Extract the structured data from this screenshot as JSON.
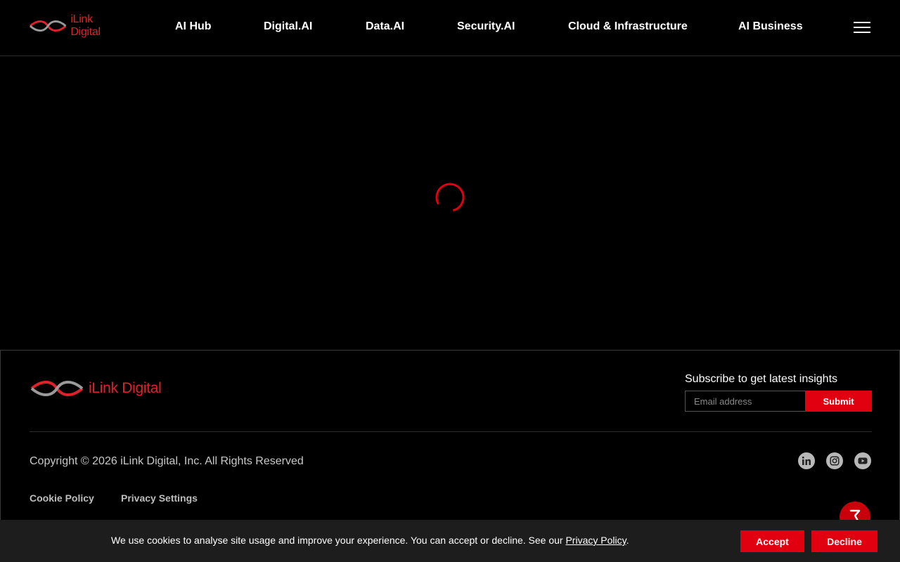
{
  "header": {
    "logo_text": "iLink Digital",
    "nav": [
      {
        "label": "AI Hub"
      },
      {
        "label": "Digital.AI"
      },
      {
        "label": "Data.AI"
      },
      {
        "label": "Security.AI"
      },
      {
        "label": "Cloud & Infrastructure"
      },
      {
        "label": "AI Business"
      }
    ]
  },
  "footer": {
    "logo_text": "iLink Digital",
    "subscribe": {
      "title": "Subscribe to get latest insights",
      "placeholder": "Email address",
      "submit_label": "Submit"
    },
    "copyright": "Copyright © 2026 iLink Digital, Inc. All Rights Reserved",
    "social": [
      "linkedin-icon",
      "instagram-icon",
      "youtube-icon"
    ],
    "links": [
      {
        "label": "Cookie Policy"
      },
      {
        "label": "Privacy Settings"
      }
    ]
  },
  "cookie_bar": {
    "text_before": "We use cookies to analyse site usage and improve your experience. You can accept or decline. See our ",
    "link_label": "Privacy Policy",
    "text_after": ".",
    "accept_label": "Accept",
    "decline_label": "Decline"
  },
  "colors": {
    "accent": "#e0000f",
    "background": "#000000",
    "cookie_bar": "#1d1d1d"
  }
}
